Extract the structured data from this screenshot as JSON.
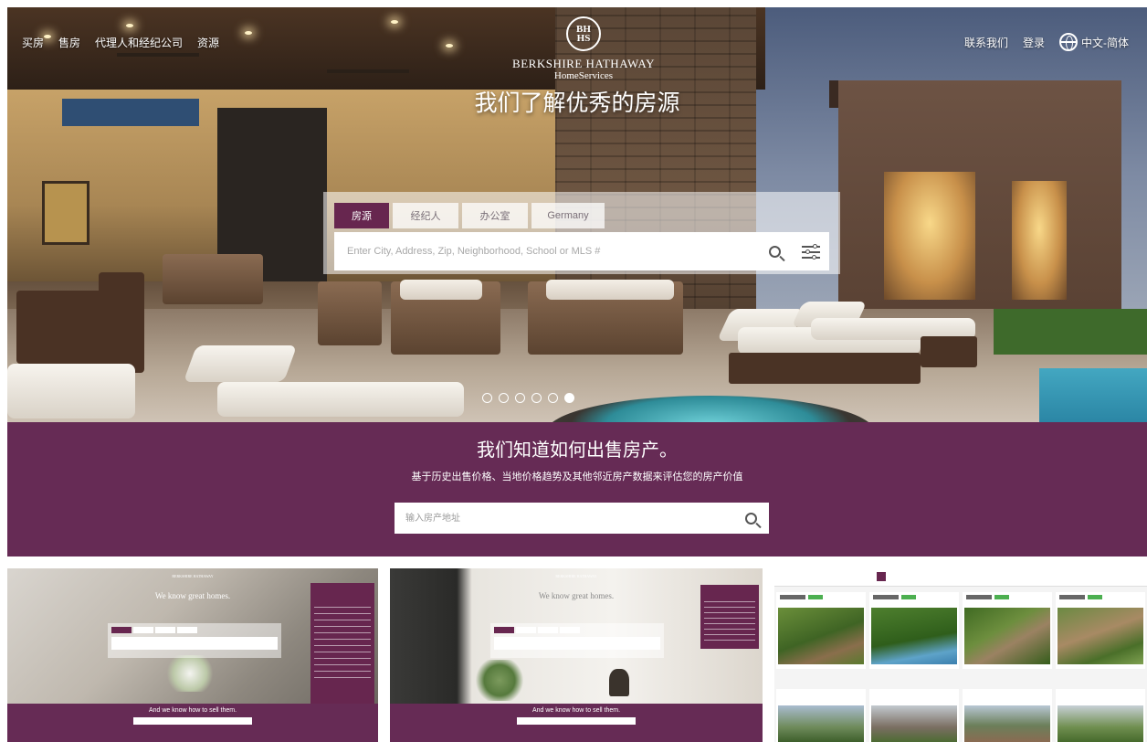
{
  "nav": {
    "left": [
      "买房",
      "售房",
      "代理人和经纪公司",
      "资源"
    ],
    "contact": "联系我们",
    "login": "登录",
    "language": "中文-简体"
  },
  "brand": {
    "seal_top": "BH",
    "seal_bottom": "HS",
    "name": "BERKSHIRE HATHAWAY",
    "sub": "HomeServices"
  },
  "hero": {
    "title": "我们了解优秀的房源",
    "tabs": [
      "房源",
      "经纪人",
      "办公室",
      "Germany"
    ],
    "active_tab": 0,
    "search_placeholder": "Enter City, Address, Zip, Neighborhood, School or MLS #",
    "slides_count": 6,
    "active_slide": 5
  },
  "sell": {
    "title": "我们知道如何出售房产。",
    "subtitle": "基于历史出售价格、当地价格趋势及其他邻近房产数据来评估您的房产价值",
    "address_placeholder": "输入房产地址"
  },
  "thumbnails": [
    {
      "hero_title": "We know great homes.",
      "sell_title": "And we know how to sell them."
    },
    {
      "hero_title": "We know great homes.",
      "sell_title": "And we know how to sell them."
    }
  ],
  "colors": {
    "brand_purple": "#662b55",
    "tab_active": "#67264f"
  },
  "icons": [
    "globe-icon",
    "search-icon",
    "filter-sliders-icon"
  ]
}
